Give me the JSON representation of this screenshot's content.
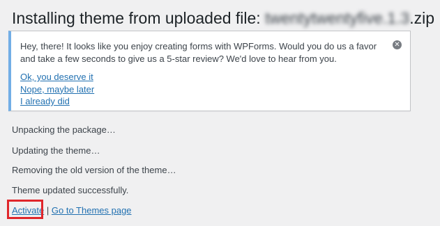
{
  "page": {
    "title_prefix": "Installing theme from uploaded file: ",
    "title_filename_blurred": "twentytwentyfive.1.3",
    "title_suffix": ".zip"
  },
  "notice": {
    "message": "Hey, there! It looks like you enjoy creating forms with WPForms. Would you do us a favor and take a few seconds to give us a 5-star review? We'd love to hear from you.",
    "links": [
      "Ok, you deserve it",
      "Nope, maybe later",
      "I already did"
    ],
    "dismiss_icon": "close-circle-icon",
    "accent_color": "#72aee6"
  },
  "log": [
    "Unpacking the package…",
    "Updating the theme…",
    "Removing the old version of the theme…",
    "Theme updated successfully."
  ],
  "actions": {
    "activate_label": "Activate",
    "themes_label": "Go to Themes page"
  },
  "colors": {
    "link": "#2271b1",
    "highlight": "#e0262b",
    "background": "#f0f0f1"
  }
}
